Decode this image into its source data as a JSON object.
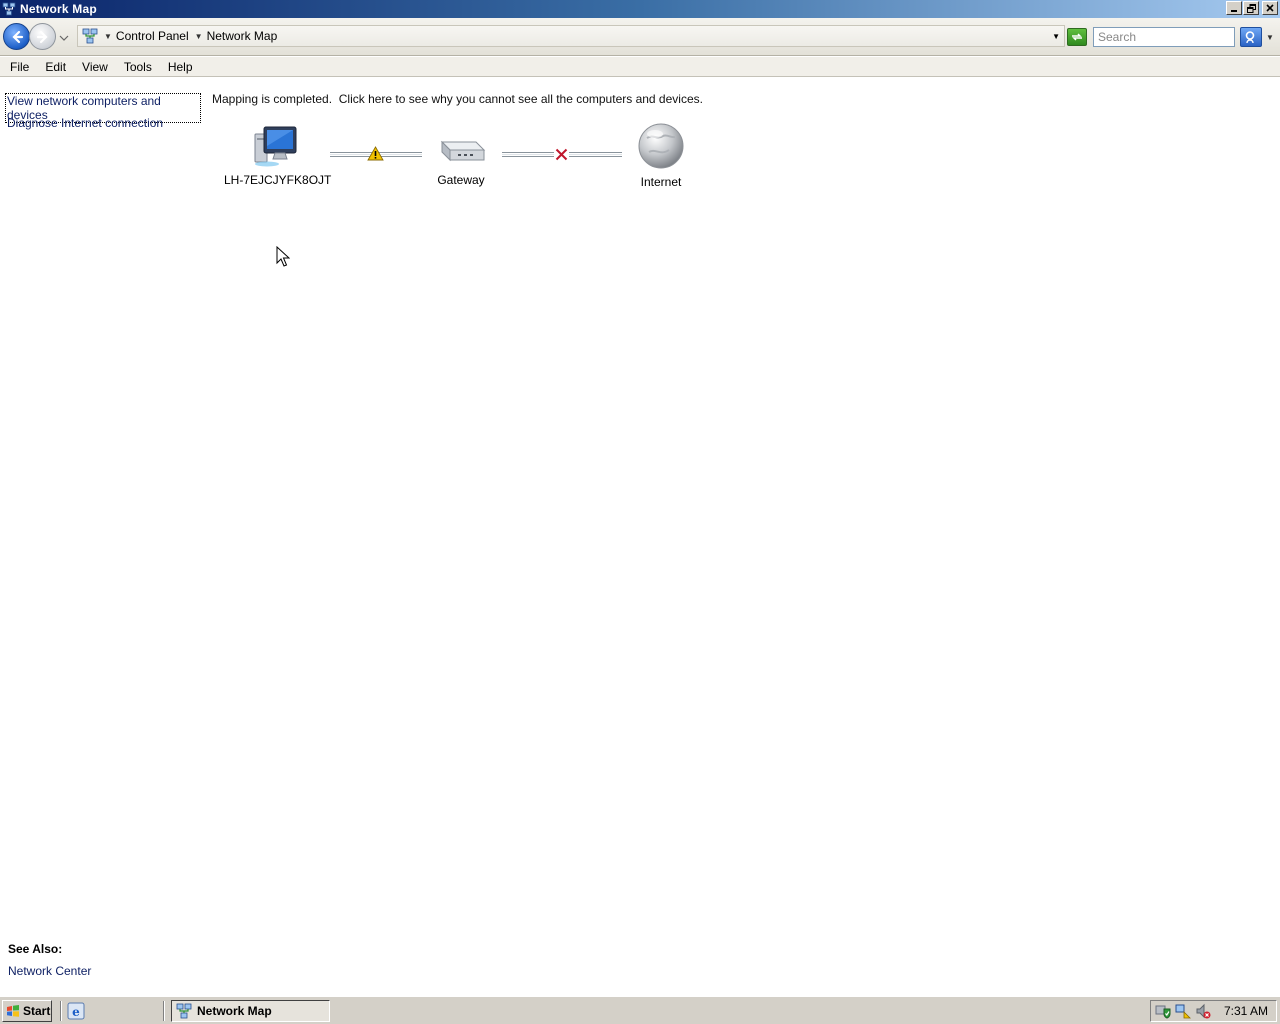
{
  "window": {
    "title": "Network Map"
  },
  "address": {
    "crumbs": [
      "Control Panel",
      "Network Map"
    ],
    "search_placeholder": "Search"
  },
  "menu": [
    "File",
    "Edit",
    "View",
    "Tools",
    "Help"
  ],
  "tasks": {
    "view_devices": "View network computers and devices",
    "diagnose": "Diagnose Internet connection"
  },
  "see_also": {
    "heading": "See Also:",
    "network_center": "Network Center"
  },
  "map": {
    "status": "Mapping is completed.",
    "click_here": "Click here to see why you cannot see all the computers and devices.",
    "nodes": [
      {
        "label": "LH-7EJCJYFK8OJT",
        "icon": "computer-icon"
      },
      {
        "label": "Gateway",
        "icon": "gateway-icon"
      },
      {
        "label": "Internet",
        "icon": "globe-icon"
      }
    ],
    "links": [
      {
        "status": "warning",
        "icon": "warning-icon"
      },
      {
        "status": "broken",
        "icon": "broken-connection-icon"
      }
    ]
  },
  "taskbar": {
    "start": "Start",
    "active_task": "Network Map",
    "clock": "7:31 AM"
  },
  "colors": {
    "title_gradient_start": "#0a246a",
    "title_gradient_end": "#a6caf0",
    "link_text": "#0d1f63",
    "warning": "#f2c200",
    "error_x": "#c0162b"
  }
}
